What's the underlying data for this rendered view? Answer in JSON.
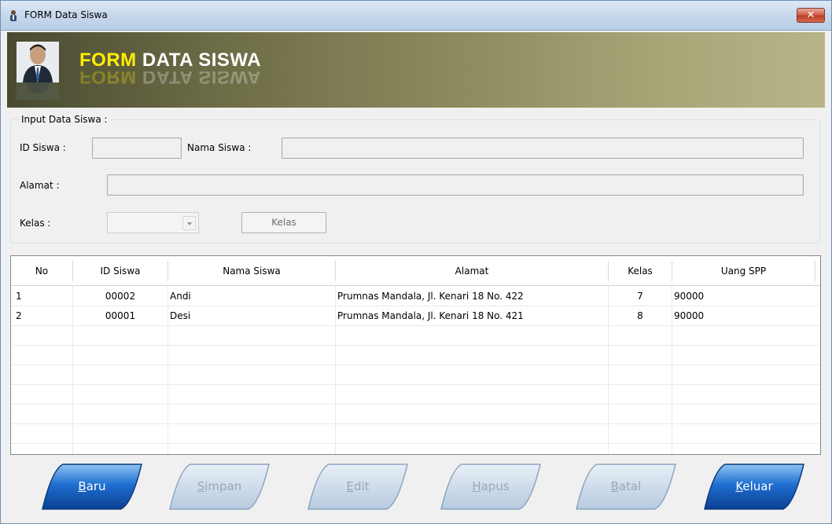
{
  "window": {
    "title": "FORM Data Siswa",
    "close_symbol": "✕"
  },
  "banner": {
    "title_word1": "FORM",
    "title_word2": "DATA SISWA"
  },
  "input_group": {
    "legend": "Input Data Siswa :",
    "id_label": "ID Siswa :",
    "id_value": "",
    "nama_label": "Nama Siswa :",
    "nama_value": "",
    "alamat_label": "Alamat :",
    "alamat_value": "",
    "kelas_label": "Kelas :",
    "kelas_value": "",
    "kelas_button": "Kelas"
  },
  "table": {
    "columns": [
      "No",
      "ID Siswa",
      "Nama Siswa",
      "Alamat",
      "Kelas",
      "Uang SPP"
    ],
    "rows": [
      [
        "1",
        "00002",
        "Andi",
        "Prumnas Mandala, Jl. Kenari 18 No. 422",
        "7",
        "90000"
      ],
      [
        "2",
        "00001",
        "Desi",
        "Prumnas Mandala, Jl. Kenari 18 No. 421",
        "8",
        "90000"
      ]
    ]
  },
  "buttons": [
    {
      "first": "B",
      "rest": "aru",
      "enabled": true
    },
    {
      "first": "S",
      "rest": "impan",
      "enabled": false
    },
    {
      "first": "E",
      "rest": "dit",
      "enabled": false
    },
    {
      "first": "H",
      "rest": "apus",
      "enabled": false
    },
    {
      "first": "B",
      "rest": "atal",
      "enabled": false
    },
    {
      "first": "K",
      "rest": "eluar",
      "enabled": true
    }
  ],
  "colors": {
    "banner_title_accent": "#ffee00",
    "button_active": "#0d4fa8",
    "button_disabled": "#c9d9ec"
  }
}
